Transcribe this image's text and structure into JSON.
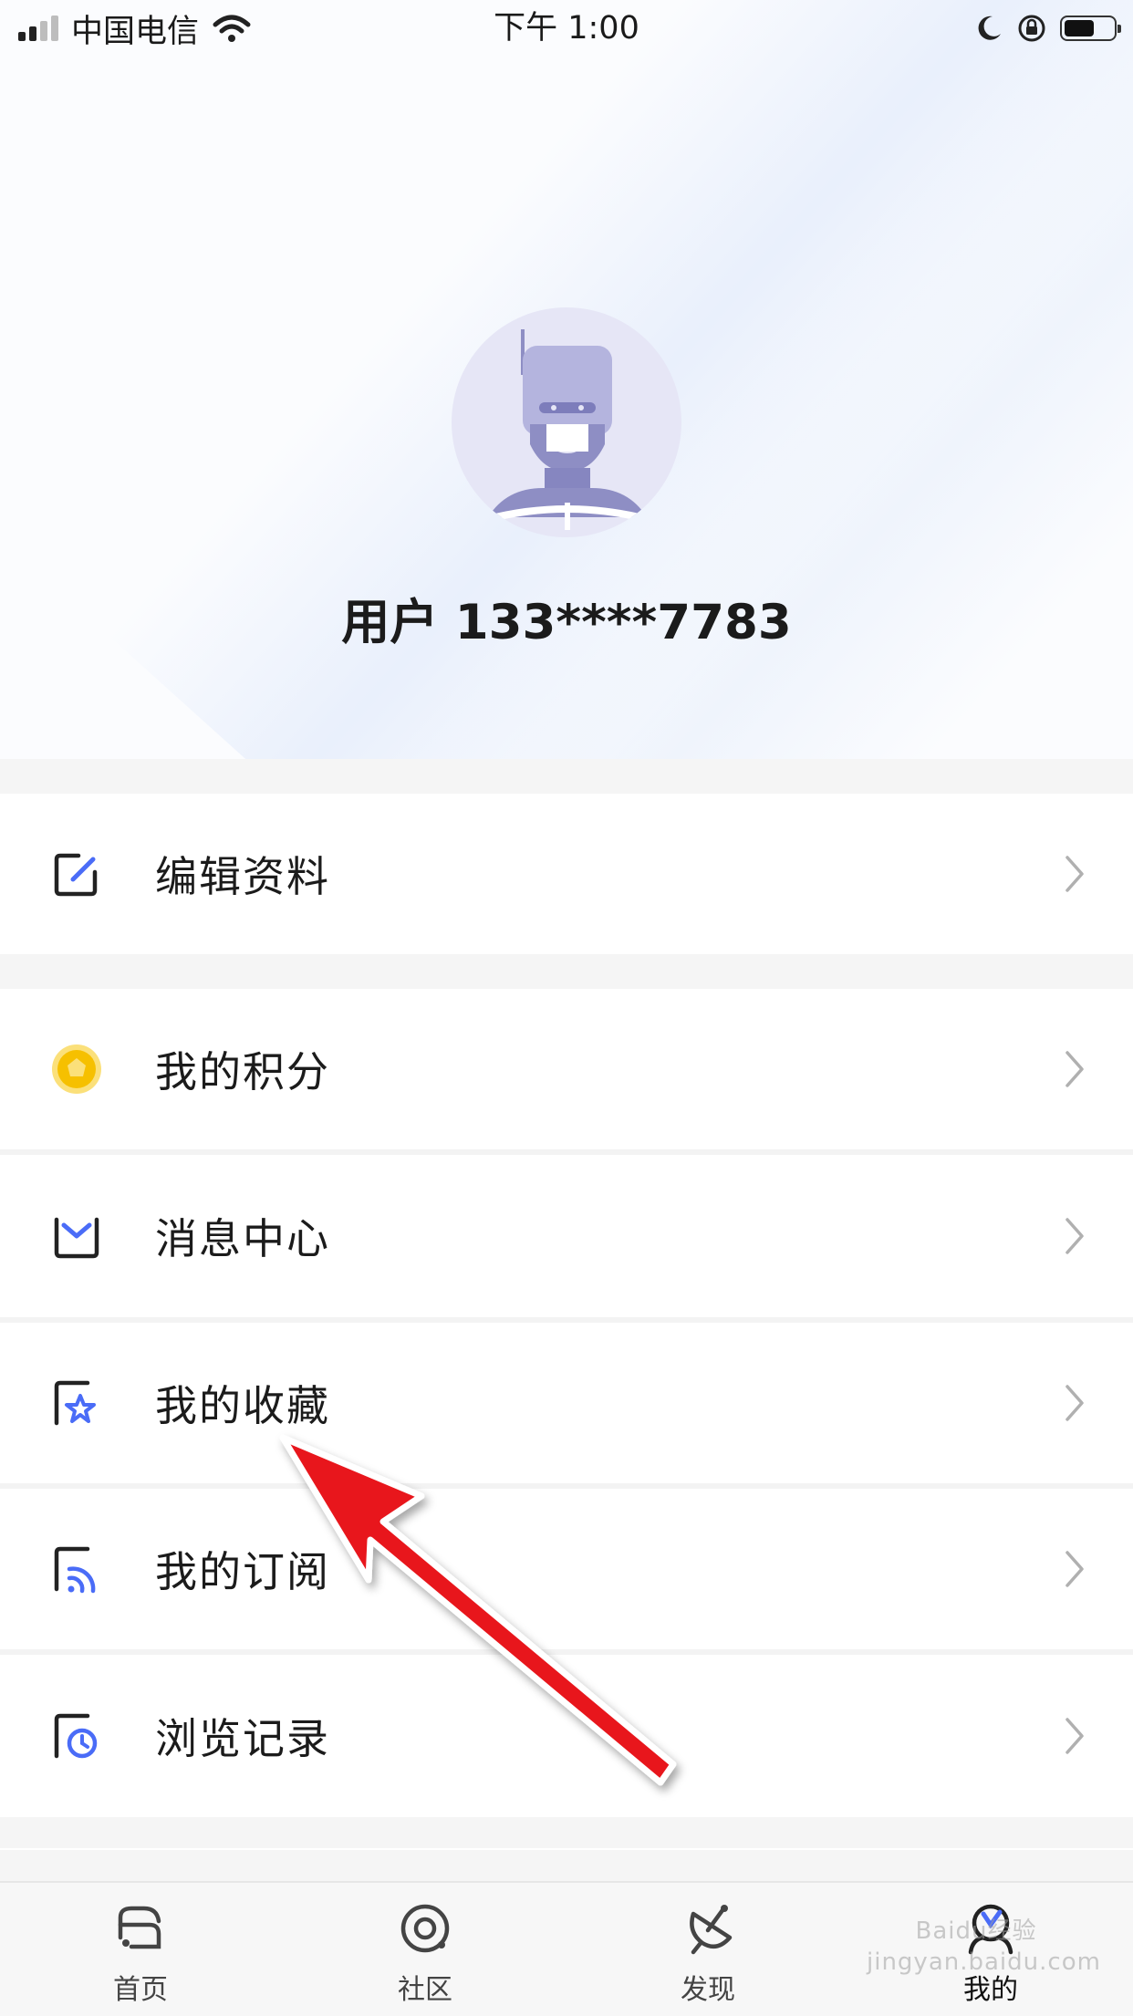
{
  "status_bar": {
    "carrier": "中国电信",
    "time": "下午 1:00"
  },
  "profile": {
    "username": "用户 133****7783"
  },
  "menu": {
    "edit_profile": "编辑资料",
    "points": "我的积分",
    "messages": "消息中心",
    "favorites": "我的收藏",
    "subscriptions": "我的订阅",
    "history": "浏览记录"
  },
  "tabbar": {
    "home": "首页",
    "community": "社区",
    "discover": "发现",
    "mine": "我的"
  },
  "watermark": "Baidu经验 jingyan.baidu.com",
  "colors": {
    "accent": "#4a6cf7",
    "arrow": "#e8141b",
    "coin": "#f6c000"
  }
}
